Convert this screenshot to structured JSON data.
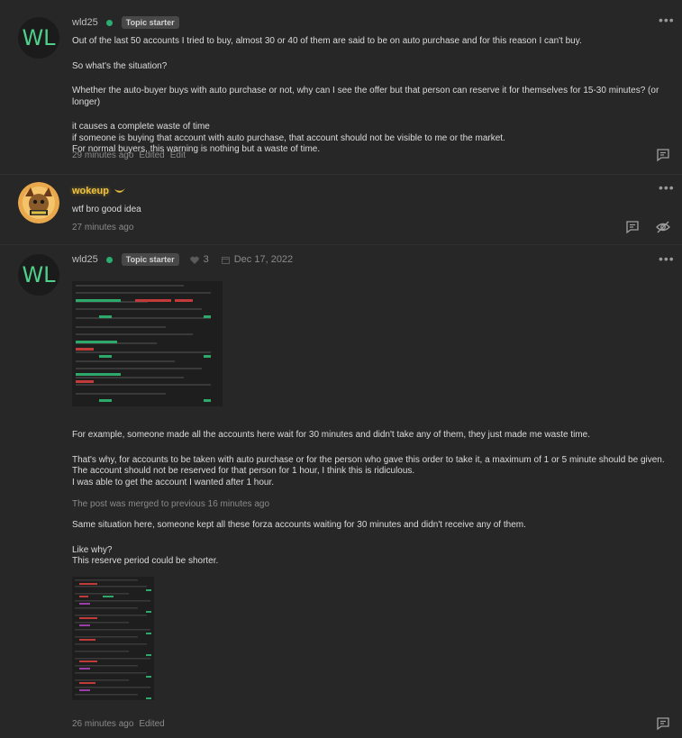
{
  "posts": [
    {
      "avatar_initials": "WL",
      "username": "wld25",
      "badge": "Topic starter",
      "paragraphs": [
        "Out of the last 50 accounts I tried to buy, almost 30 or 40 of them are said to be on auto purchase and for this reason I can't buy.",
        "So what's the situation?",
        "Whether the auto-buyer buys with auto purchase or not, why can I see the offer but that person can reserve it for themselves for 15-30 minutes? (or longer)",
        "it causes a complete waste of time",
        "if someone is buying that account with auto purchase, that account should not be visible to me or the market.",
        "For normal buyers, this warning is nothing but a waste of time."
      ],
      "time": "29 minutes ago",
      "edited": "Edited",
      "edit": "Edit"
    },
    {
      "username": "wokeup",
      "text": "wtf bro good idea",
      "time": "27 minutes ago"
    },
    {
      "avatar_initials": "WL",
      "username": "wld25",
      "badge": "Topic starter",
      "likes": "3",
      "date": "Dec 17, 2022",
      "block1": [
        "For example, someone made all the accounts here wait for 30 minutes and didn't take any of them, they just made me waste time.",
        "That's why, for accounts to be taken with auto purchase or for the person who gave this order to take it, a maximum of 1 or 5 minute should be given.",
        "The account should not be reserved for that person for 1 hour, I think this is ridiculous.",
        "I was able to get the account I wanted after 1 hour."
      ],
      "merged": "The post was merged to previous 16 minutes ago",
      "block2": [
        "Same situation here, someone kept all these forza accounts waiting for 30 minutes and didn't receive any of them.",
        "Like why?",
        "This reserve period could be shorter."
      ],
      "time": "26 minutes ago",
      "edited": "Edited"
    }
  ],
  "colors": {
    "accent": "#2bad72",
    "gold": "#f0c23c",
    "background": "#272727"
  }
}
